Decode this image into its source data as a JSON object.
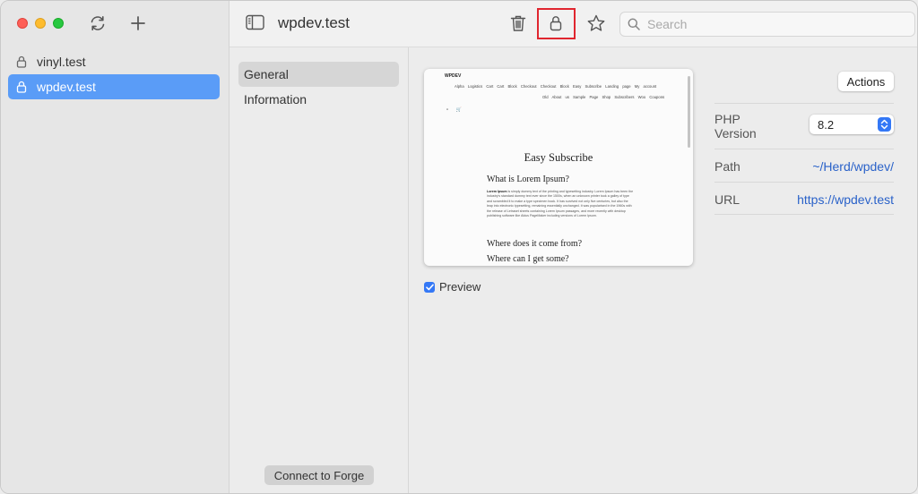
{
  "sidebar": {
    "sites": [
      {
        "name": "vinyl.test",
        "selected": false
      },
      {
        "name": "wpdev.test",
        "selected": true
      }
    ]
  },
  "toolbar": {
    "title": "wpdev.test",
    "search_placeholder": "Search"
  },
  "nav": {
    "items": [
      {
        "label": "General",
        "active": true
      },
      {
        "label": "Information",
        "active": false
      }
    ],
    "connect_button": "Connect to Forge"
  },
  "preview": {
    "logo": "WPDEV",
    "nav_row1": "Alpha Logistics Cart Cart Block Checkout Checkout Block Easy Subscribe Landing page My account",
    "nav_row2": "Old About us Sample Page Shop Subscribers Woo Coupons",
    "heading": "Easy Subscribe",
    "subheading": "What is Lorem Ipsum?",
    "body_bold": "Lorem Ipsum",
    "body": " is simply dummy text of the printing and typesetting industry. Lorem Ipsum has been the industry's standard dummy text ever since the 1500s, when an unknown printer took a galley of type and scrambled it to make a type specimen book. It has survived not only five centuries, but also the leap into electronic typesetting, remaining essentially unchanged. It was popularised in the 1960s with the release of Letraset sheets containing Lorem Ipsum passages, and more recently with desktop publishing software like Aldus PageMaker including versions of Lorem Ipsum.",
    "heading2": "Where does it come from?",
    "heading3": "Where can I get some?",
    "checkbox_label": "Preview",
    "checkbox_checked": true
  },
  "details": {
    "actions_label": "Actions",
    "php_label": "PHP Version",
    "php_label_line1": "PHP",
    "php_label_line2": "Version",
    "php_value": "8.2",
    "path_label": "Path",
    "path_value": "~/Herd/wpdev/",
    "url_label": "URL",
    "url_value": "https://wpdev.test"
  },
  "colors": {
    "selection": "#5a9cf7",
    "link": "#2a62c9",
    "highlight_box": "#e0262f",
    "accent": "#3478f6"
  }
}
